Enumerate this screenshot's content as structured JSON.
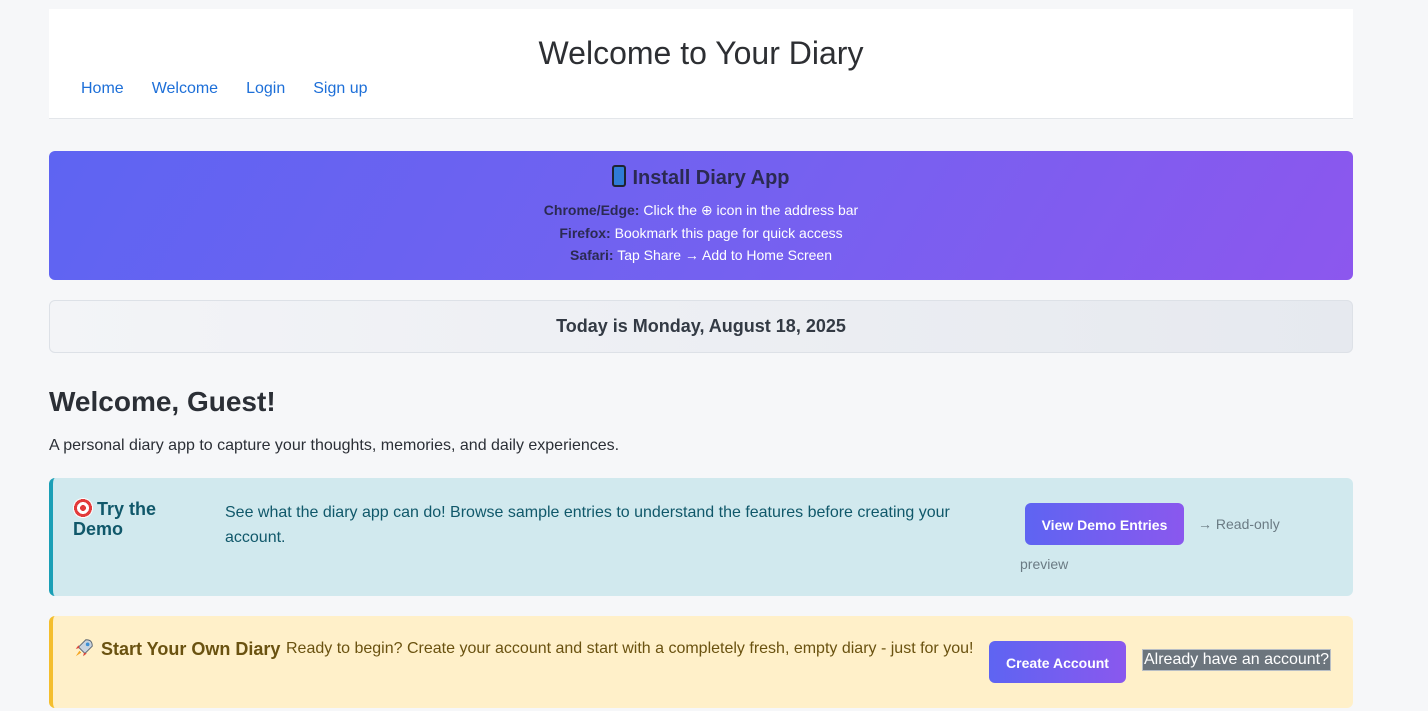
{
  "header": {
    "title": "Welcome to Your Diary",
    "nav": [
      "Home",
      "Welcome",
      "Login",
      "Sign up"
    ]
  },
  "install": {
    "title": "Install Diary App",
    "chrome_label": "Chrome/Edge:",
    "chrome_text": "Click the ⊕ icon in the address bar",
    "firefox_label": "Firefox:",
    "firefox_text": "Bookmark this page for quick access",
    "safari_label": "Safari:",
    "safari_text": "Tap Share → Add to Home Screen"
  },
  "today": "Today is Monday, August 18, 2025",
  "main": {
    "heading": "Welcome, Guest!",
    "intro": "A personal diary app to capture your thoughts, memories, and daily experiences."
  },
  "demo": {
    "title": "Try the Demo",
    "description": "See what the diary app can do! Browse sample entries to understand the features before creating your account.",
    "button": "View Demo Entries",
    "note_arrow": "→ Read-only",
    "note_word": "preview"
  },
  "start": {
    "title": "Start Your Own Diary",
    "description": "Ready to begin? Create your account and start with a completely fresh, empty diary - just for you!",
    "button": "Create Account",
    "login_link": "Already have an account?"
  },
  "colors": {
    "accent_start": "#5e64f2",
    "accent_end": "#8a58ee",
    "link": "#1d6fd8",
    "demo_bg": "#d1e9ee",
    "demo_border": "#1a9fb6",
    "start_bg": "#fff0c9",
    "start_border": "#f4be2d"
  },
  "icons": {
    "install": "mobile-phone-icon",
    "demo": "target-icon",
    "start": "rocket-icon"
  }
}
